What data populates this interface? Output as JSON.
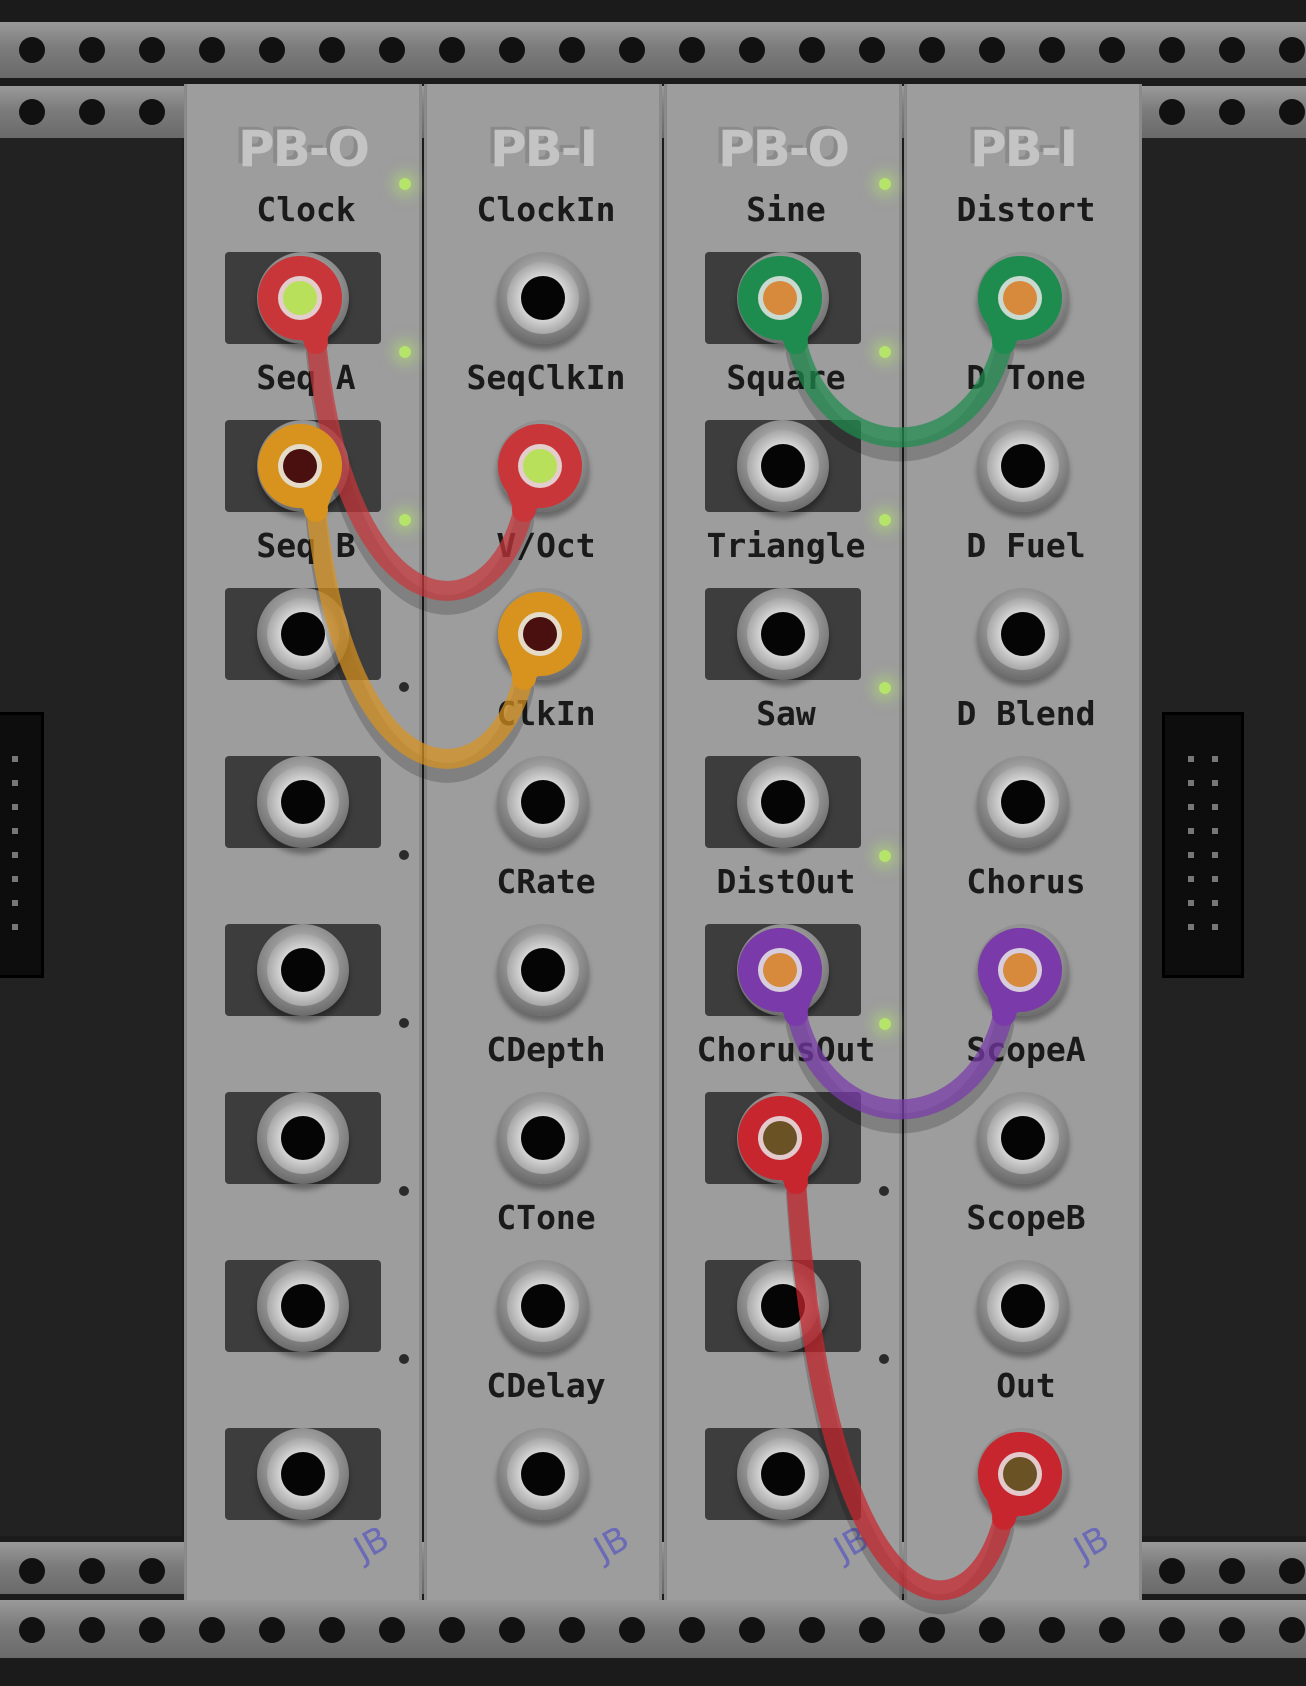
{
  "modules": [
    {
      "title": "PB-O",
      "brand": "JB",
      "rows": [
        {
          "label": "Clock",
          "led": "on"
        },
        {
          "label": "Seq A",
          "led": "on"
        },
        {
          "label": "Seq B",
          "led": "on"
        },
        {
          "label": "",
          "led": "off"
        },
        {
          "label": "",
          "led": "off"
        },
        {
          "label": "",
          "led": "off"
        },
        {
          "label": "",
          "led": "off"
        },
        {
          "label": "",
          "led": "off"
        }
      ]
    },
    {
      "title": "PB-I",
      "brand": "JB",
      "rows": [
        {
          "label": "ClockIn"
        },
        {
          "label": "SeqClkIn"
        },
        {
          "label": "V/Oct"
        },
        {
          "label": "ClkIn"
        },
        {
          "label": "CRate"
        },
        {
          "label": "CDepth"
        },
        {
          "label": "CTone"
        },
        {
          "label": "CDelay"
        }
      ]
    },
    {
      "title": "PB-O",
      "brand": "JB",
      "rows": [
        {
          "label": "Sine",
          "led": "on"
        },
        {
          "label": "Square",
          "led": "on"
        },
        {
          "label": "Triangle",
          "led": "on"
        },
        {
          "label": "Saw",
          "led": "on"
        },
        {
          "label": "DistOut",
          "led": "on"
        },
        {
          "label": "ChorusOut",
          "led": "on"
        },
        {
          "label": "",
          "led": "off"
        },
        {
          "label": "",
          "led": "off"
        }
      ]
    },
    {
      "title": "PB-I",
      "brand": "JB",
      "rows": [
        {
          "label": "Distort"
        },
        {
          "label": "D Tone"
        },
        {
          "label": "D Fuel"
        },
        {
          "label": "D Blend"
        },
        {
          "label": "Chorus"
        },
        {
          "label": "ScopeA"
        },
        {
          "label": "ScopeB"
        },
        {
          "label": "Out"
        }
      ]
    }
  ],
  "cables": [
    {
      "from": [
        0,
        0
      ],
      "to": [
        1,
        1
      ],
      "color": "#c8363a",
      "plug": "#b8e05a"
    },
    {
      "from": [
        0,
        1
      ],
      "to": [
        1,
        2
      ],
      "color": "#d8921e",
      "plug": "#4a0f0f"
    },
    {
      "from": [
        2,
        0
      ],
      "to": [
        3,
        0
      ],
      "color": "#1f8c4f",
      "plug": "#d88a3c"
    },
    {
      "from": [
        2,
        4
      ],
      "to": [
        3,
        4
      ],
      "color": "#7a3aaa",
      "plug": "#d88a3c"
    },
    {
      "from": [
        2,
        5
      ],
      "to": [
        3,
        7
      ],
      "color": "#c8262e",
      "plug": "#6a5224"
    }
  ]
}
